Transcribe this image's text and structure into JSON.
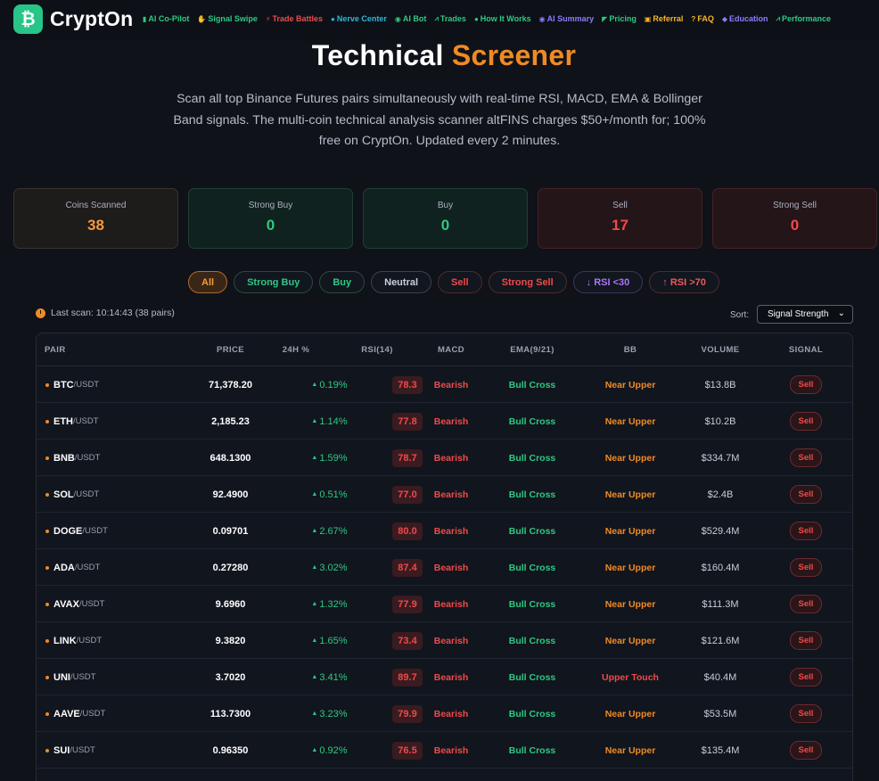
{
  "nav": {
    "brand": "CryptOn",
    "logo_glyph": "₿",
    "links": [
      {
        "icon": "▮",
        "label": "AI Co-Pilot",
        "color": "#2ec983"
      },
      {
        "icon": "✋",
        "label": "Signal Swipe",
        "color": "#2ec983"
      },
      {
        "icon": "⚡",
        "label": "Trade Battles",
        "color": "#ef4a4a"
      },
      {
        "icon": "●",
        "label": "Nerve Center",
        "color": "#2bb8d8"
      },
      {
        "icon": "◉",
        "label": "AI Bot",
        "color": "#2ec983"
      },
      {
        "icon": "⩘",
        "label": "Trades",
        "color": "#2ec983"
      },
      {
        "icon": "●",
        "label": "How It Works",
        "color": "#2ec983"
      },
      {
        "icon": "◉",
        "label": "AI Summary",
        "color": "#8a7cff"
      },
      {
        "icon": "◤",
        "label": "Pricing",
        "color": "#2ec983"
      },
      {
        "icon": "▣",
        "label": "Referral",
        "color": "#f5b62a"
      },
      {
        "icon": "?",
        "label": "FAQ",
        "color": "#f5b62a"
      },
      {
        "icon": "◆",
        "label": "Education",
        "color": "#8a7cff"
      },
      {
        "icon": "⩘",
        "label": "Performance",
        "color": "#2ec983"
      }
    ]
  },
  "hero": {
    "title_main": "Technical",
    "title_accent": "Screener",
    "description": "Scan all top Binance Futures pairs simultaneously with real-time RSI, MACD, EMA & Bollinger Band signals. The multi-coin technical analysis scanner altFINS charges $50+/month for; 100% free on CryptOn. Updated every 2 minutes."
  },
  "stats": [
    {
      "label": "Coins Scanned",
      "value": "38",
      "color": "#f59a3c"
    },
    {
      "label": "Strong Buy",
      "value": "0",
      "color": "#2ec983"
    },
    {
      "label": "Buy",
      "value": "0",
      "color": "#2ec983"
    },
    {
      "label": "Sell",
      "value": "17",
      "color": "#ef4a4a"
    },
    {
      "label": "Strong Sell",
      "value": "0",
      "color": "#ef4a4a"
    }
  ],
  "filters": {
    "all": "All",
    "strong_buy": "Strong Buy",
    "buy": "Buy",
    "neutral": "Neutral",
    "sell": "Sell",
    "strong_sell": "Strong Sell",
    "rsi_low": "↓ RSI <30",
    "rsi_high": "↑ RSI >70"
  },
  "scan": {
    "last_scan": "Last scan: 10:14:43 (38 pairs)"
  },
  "sort": {
    "label": "Sort:",
    "selected": "Signal Strength"
  },
  "table": {
    "headers": {
      "pair": "PAIR",
      "price": "PRICE",
      "change": "24H %",
      "rsi": "RSI(14)",
      "macd": "MACD",
      "ema": "EMA(9/21)",
      "bb": "BB",
      "volume": "VOLUME",
      "signal": "SIGNAL"
    },
    "rows": [
      {
        "sym": "BTC",
        "quote": "/USDT",
        "price": "71,378.20",
        "change": "0.19%",
        "rsi": "78.3",
        "macd": "Bearish",
        "ema": "Bull Cross",
        "bb": "Near Upper",
        "volume": "$13.8B",
        "signal": "Sell"
      },
      {
        "sym": "ETH",
        "quote": "/USDT",
        "price": "2,185.23",
        "change": "1.14%",
        "rsi": "77.8",
        "macd": "Bearish",
        "ema": "Bull Cross",
        "bb": "Near Upper",
        "volume": "$10.2B",
        "signal": "Sell"
      },
      {
        "sym": "BNB",
        "quote": "/USDT",
        "price": "648.1300",
        "change": "1.59%",
        "rsi": "78.7",
        "macd": "Bearish",
        "ema": "Bull Cross",
        "bb": "Near Upper",
        "volume": "$334.7M",
        "signal": "Sell"
      },
      {
        "sym": "SOL",
        "quote": "/USDT",
        "price": "92.4900",
        "change": "0.51%",
        "rsi": "77.0",
        "macd": "Bearish",
        "ema": "Bull Cross",
        "bb": "Near Upper",
        "volume": "$2.4B",
        "signal": "Sell"
      },
      {
        "sym": "DOGE",
        "quote": "/USDT",
        "price": "0.09701",
        "change": "2.67%",
        "rsi": "80.0",
        "macd": "Bearish",
        "ema": "Bull Cross",
        "bb": "Near Upper",
        "volume": "$529.4M",
        "signal": "Sell"
      },
      {
        "sym": "ADA",
        "quote": "/USDT",
        "price": "0.27280",
        "change": "3.02%",
        "rsi": "87.4",
        "macd": "Bearish",
        "ema": "Bull Cross",
        "bb": "Near Upper",
        "volume": "$160.4M",
        "signal": "Sell"
      },
      {
        "sym": "AVAX",
        "quote": "/USDT",
        "price": "9.6960",
        "change": "1.32%",
        "rsi": "77.9",
        "macd": "Bearish",
        "ema": "Bull Cross",
        "bb": "Near Upper",
        "volume": "$111.3M",
        "signal": "Sell"
      },
      {
        "sym": "LINK",
        "quote": "/USDT",
        "price": "9.3820",
        "change": "1.65%",
        "rsi": "73.4",
        "macd": "Bearish",
        "ema": "Bull Cross",
        "bb": "Near Upper",
        "volume": "$121.6M",
        "signal": "Sell"
      },
      {
        "sym": "UNI",
        "quote": "/USDT",
        "price": "3.7020",
        "change": "3.41%",
        "rsi": "89.7",
        "macd": "Bearish",
        "ema": "Bull Cross",
        "bb": "Upper Touch",
        "volume": "$40.4M",
        "signal": "Sell"
      },
      {
        "sym": "AAVE",
        "quote": "/USDT",
        "price": "113.7300",
        "change": "3.23%",
        "rsi": "79.9",
        "macd": "Bearish",
        "ema": "Bull Cross",
        "bb": "Near Upper",
        "volume": "$53.5M",
        "signal": "Sell"
      },
      {
        "sym": "SUI",
        "quote": "/USDT",
        "price": "0.96350",
        "change": "0.92%",
        "rsi": "76.5",
        "macd": "Bearish",
        "ema": "Bull Cross",
        "bb": "Near Upper",
        "volume": "$135.4M",
        "signal": "Sell"
      }
    ]
  }
}
